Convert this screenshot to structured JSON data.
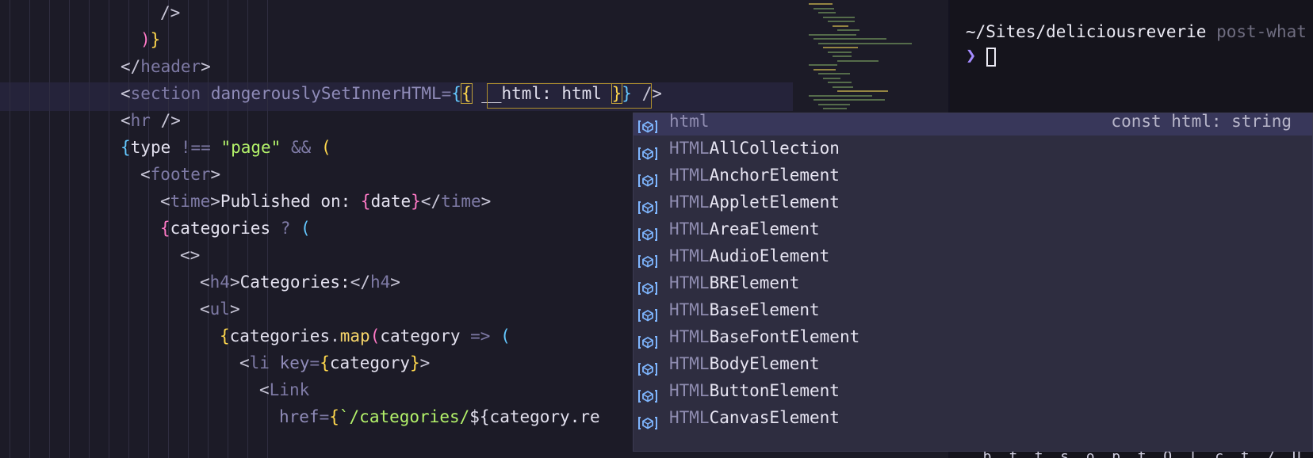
{
  "editor": {
    "lines": [
      {
        "indent": 8,
        "tokens": [
          {
            "t": "/>",
            "c": "t-punct"
          }
        ]
      },
      {
        "indent": 7,
        "tokens": [
          {
            "t": ")",
            "c": "t-b2"
          },
          {
            "t": "}",
            "c": "t-b1"
          }
        ]
      },
      {
        "indent": 6,
        "tokens": [
          {
            "t": "</",
            "c": "t-punct"
          },
          {
            "t": "header",
            "c": "t-tag"
          },
          {
            "t": ">",
            "c": "t-punct"
          }
        ]
      },
      {
        "indent": 6,
        "tokens": [
          {
            "t": "<",
            "c": "t-punct"
          },
          {
            "t": "section",
            "c": "t-tag"
          },
          {
            "t": " ",
            "c": "t-text"
          },
          {
            "t": "dangerouslySetInnerHTML",
            "c": "t-attr"
          },
          {
            "t": "=",
            "c": "t-op"
          },
          {
            "t": "{",
            "c": "t-b3"
          },
          {
            "t": "{",
            "c": "t-b1 bracket-box"
          },
          {
            "t": " __html: html ",
            "c": "t-text"
          },
          {
            "t": "}",
            "c": "t-b1 bracket-box"
          },
          {
            "t": "}",
            "c": "t-b3"
          },
          {
            "t": " />",
            "c": "t-punct"
          }
        ]
      },
      {
        "indent": 6,
        "tokens": [
          {
            "t": "<",
            "c": "t-punct"
          },
          {
            "t": "hr",
            "c": "t-tag"
          },
          {
            "t": " />",
            "c": "t-punct"
          }
        ]
      },
      {
        "indent": 6,
        "tokens": [
          {
            "t": "{",
            "c": "t-b3"
          },
          {
            "t": "type ",
            "c": "t-text"
          },
          {
            "t": "!==",
            "c": "t-op"
          },
          {
            "t": " ",
            "c": "t-text"
          },
          {
            "t": "\"page\"",
            "c": "t-str"
          },
          {
            "t": " ",
            "c": "t-text"
          },
          {
            "t": "&&",
            "c": "t-op"
          },
          {
            "t": " ",
            "c": "t-text"
          },
          {
            "t": "(",
            "c": "t-b1"
          }
        ]
      },
      {
        "indent": 7,
        "tokens": [
          {
            "t": "<",
            "c": "t-punct"
          },
          {
            "t": "footer",
            "c": "t-tag"
          },
          {
            "t": ">",
            "c": "t-punct"
          }
        ]
      },
      {
        "indent": 8,
        "tokens": [
          {
            "t": "<",
            "c": "t-punct"
          },
          {
            "t": "time",
            "c": "t-tag"
          },
          {
            "t": ">",
            "c": "t-punct"
          },
          {
            "t": "Published on: ",
            "c": "t-text"
          },
          {
            "t": "{",
            "c": "t-b2"
          },
          {
            "t": "date",
            "c": "t-text"
          },
          {
            "t": "}",
            "c": "t-b2"
          },
          {
            "t": "</",
            "c": "t-punct"
          },
          {
            "t": "time",
            "c": "t-tag"
          },
          {
            "t": ">",
            "c": "t-punct"
          }
        ]
      },
      {
        "indent": 8,
        "tokens": [
          {
            "t": "{",
            "c": "t-b2"
          },
          {
            "t": "categories ",
            "c": "t-text"
          },
          {
            "t": "?",
            "c": "t-op"
          },
          {
            "t": " ",
            "c": "t-text"
          },
          {
            "t": "(",
            "c": "t-b3"
          }
        ]
      },
      {
        "indent": 9,
        "tokens": [
          {
            "t": "<>",
            "c": "t-punct"
          }
        ]
      },
      {
        "indent": 10,
        "tokens": [
          {
            "t": "<",
            "c": "t-punct"
          },
          {
            "t": "h4",
            "c": "t-tag"
          },
          {
            "t": ">",
            "c": "t-punct"
          },
          {
            "t": "Categories:",
            "c": "t-text"
          },
          {
            "t": "</",
            "c": "t-punct"
          },
          {
            "t": "h4",
            "c": "t-tag"
          },
          {
            "t": ">",
            "c": "t-punct"
          }
        ]
      },
      {
        "indent": 10,
        "tokens": [
          {
            "t": "<",
            "c": "t-punct"
          },
          {
            "t": "ul",
            "c": "t-tag"
          },
          {
            "t": ">",
            "c": "t-punct"
          }
        ]
      },
      {
        "indent": 11,
        "tokens": [
          {
            "t": "{",
            "c": "t-b1"
          },
          {
            "t": "categories",
            "c": "t-text"
          },
          {
            "t": ".",
            "c": "t-punct"
          },
          {
            "t": "map",
            "c": "t-fn"
          },
          {
            "t": "(",
            "c": "t-b2"
          },
          {
            "t": "category ",
            "c": "t-text"
          },
          {
            "t": "=>",
            "c": "t-op"
          },
          {
            "t": " ",
            "c": "t-text"
          },
          {
            "t": "(",
            "c": "t-b3"
          }
        ]
      },
      {
        "indent": 12,
        "tokens": [
          {
            "t": "<",
            "c": "t-punct"
          },
          {
            "t": "li",
            "c": "t-tag"
          },
          {
            "t": " ",
            "c": "t-text"
          },
          {
            "t": "key",
            "c": "t-attr"
          },
          {
            "t": "=",
            "c": "t-op"
          },
          {
            "t": "{",
            "c": "t-b1"
          },
          {
            "t": "category",
            "c": "t-text"
          },
          {
            "t": "}",
            "c": "t-b1"
          },
          {
            "t": ">",
            "c": "t-punct"
          }
        ]
      },
      {
        "indent": 13,
        "tokens": [
          {
            "t": "<",
            "c": "t-punct"
          },
          {
            "t": "Link",
            "c": "t-tag"
          }
        ]
      },
      {
        "indent": 14,
        "tokens": [
          {
            "t": "href",
            "c": "t-attr"
          },
          {
            "t": "=",
            "c": "t-op"
          },
          {
            "t": "{",
            "c": "t-b1"
          },
          {
            "t": "`/categories/",
            "c": "t-str"
          },
          {
            "t": "${category.re",
            "c": "t-text"
          }
        ]
      }
    ]
  },
  "terminal": {
    "path": "~/Sites/deliciousreverie",
    "branch": " post-what",
    "prompt": "❯",
    "bottom_text": "  b  f  t  s  o  p  t  O  l  c  t  /  U  s  c  /  b  e  t"
  },
  "suggest": {
    "items": [
      {
        "prefix": "html",
        "rest": "",
        "detail": "const html: string",
        "selected": true
      },
      {
        "prefix": "HTML",
        "rest": "AllCollection",
        "detail": "",
        "selected": false
      },
      {
        "prefix": "HTML",
        "rest": "AnchorElement",
        "detail": "",
        "selected": false
      },
      {
        "prefix": "HTML",
        "rest": "AppletElement",
        "detail": "",
        "selected": false
      },
      {
        "prefix": "HTML",
        "rest": "AreaElement",
        "detail": "",
        "selected": false
      },
      {
        "prefix": "HTML",
        "rest": "AudioElement",
        "detail": "",
        "selected": false
      },
      {
        "prefix": "HTML",
        "rest": "BRElement",
        "detail": "",
        "selected": false
      },
      {
        "prefix": "HTML",
        "rest": "BaseElement",
        "detail": "",
        "selected": false
      },
      {
        "prefix": "HTML",
        "rest": "BaseFontElement",
        "detail": "",
        "selected": false
      },
      {
        "prefix": "HTML",
        "rest": "BodyElement",
        "detail": "",
        "selected": false
      },
      {
        "prefix": "HTML",
        "rest": "ButtonElement",
        "detail": "",
        "selected": false
      },
      {
        "prefix": "HTML",
        "rest": "CanvasElement",
        "detail": "",
        "selected": false
      }
    ],
    "icon": "variable-icon",
    "icon_color": "#7fb6ff"
  }
}
